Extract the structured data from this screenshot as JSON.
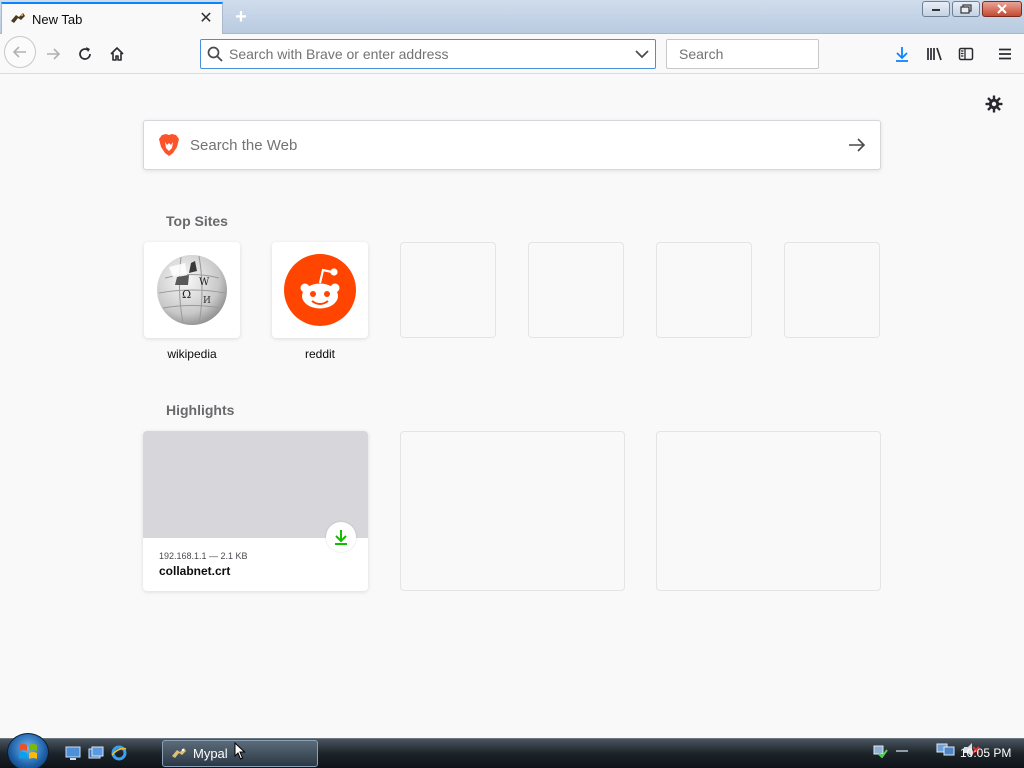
{
  "browser": {
    "tab": {
      "title": "New Tab"
    },
    "urlbar": {
      "placeholder": "Search with Brave or enter address"
    },
    "searchbar": {
      "placeholder": "Search"
    }
  },
  "page": {
    "websearch": {
      "placeholder": "Search the Web"
    },
    "topsites": {
      "title": "Top Sites",
      "items": [
        {
          "label": "wikipedia",
          "icon": "wikipedia-logo"
        },
        {
          "label": "reddit",
          "icon": "reddit-logo"
        }
      ]
    },
    "highlights": {
      "title": "Highlights",
      "items": [
        {
          "meta": "192.168.1.1 — 2.1 KB",
          "filename": "collabnet.crt",
          "icon": "download-icon"
        }
      ]
    }
  },
  "taskbar": {
    "task_label": "Mypal",
    "clock": "10:05 PM"
  },
  "colors": {
    "accent": "#0a84ff",
    "reddit": "#ff4500",
    "download_green": "#12bc00"
  }
}
